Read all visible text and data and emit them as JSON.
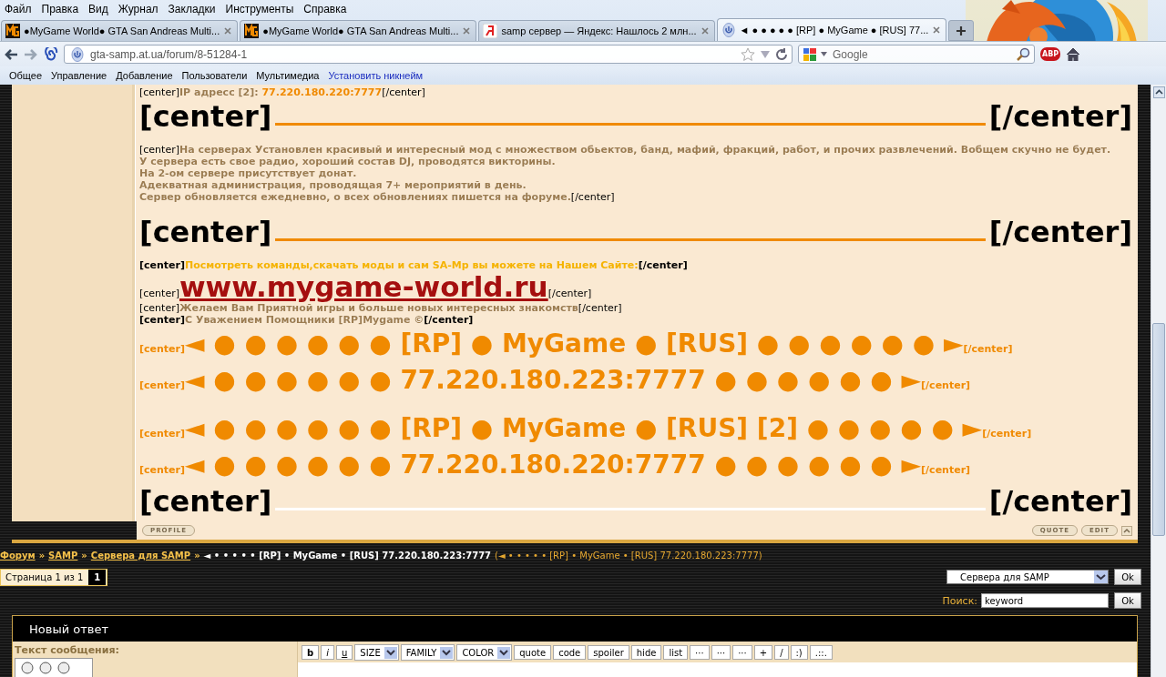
{
  "menu": [
    "Файл",
    "Правка",
    "Вид",
    "Журнал",
    "Закладки",
    "Инструменты",
    "Справка"
  ],
  "tabs": [
    {
      "title": "●MyGame World● GTA San Andreas Multi...",
      "kind": "game",
      "selected": false
    },
    {
      "title": "●MyGame World● GTA San Andreas Multi...",
      "kind": "game",
      "selected": false
    },
    {
      "title": "samp сервер — Яндекс: Нашлось 2 млн...",
      "kind": "search",
      "selected": false
    },
    {
      "title": "◄ ● ● ● ● ● [RP] ● MyGame ● [RUS] 77...",
      "kind": "site",
      "selected": true
    }
  ],
  "address": {
    "url": "gta-samp.at.ua/forum/8-51284-1"
  },
  "web_search": {
    "placeholder": "Google"
  },
  "addon_badge": "ABP",
  "bookmarks": [
    {
      "label": "Общее",
      "kind": "menu"
    },
    {
      "label": "Управление",
      "kind": "menu"
    },
    {
      "label": "Добавление",
      "kind": "menu"
    },
    {
      "label": "Пользователи",
      "kind": "menu"
    },
    {
      "label": "Мультимедиа",
      "kind": "menu"
    },
    {
      "label": "Установить никнейм",
      "kind": "link"
    }
  ],
  "post": {
    "lines": [
      {
        "kind": "text",
        "segments": [
          {
            "text": "[center]",
            "kind": "tag"
          },
          {
            "text": "IP адресс [2]: ",
            "kind": "white"
          },
          {
            "text": "77.220.180.220:7777",
            "kind": "orange"
          },
          {
            "text": "[/center]",
            "kind": "tag"
          }
        ]
      },
      {
        "kind": "divider",
        "left": "[center]",
        "right": "[/center]"
      },
      {
        "kind": "text",
        "segments": [
          {
            "text": "[center]",
            "kind": "tag"
          },
          {
            "text": "На серверах Установлен красивый и интересный мод с множеством обьектов, банд, мафий, фракций, работ, и прочих развлечений. Вобщем скучно не будет.",
            "kind": "white"
          }
        ]
      },
      {
        "kind": "text",
        "segments": [
          {
            "text": "У сервера есть свое радио, хороший состав DJ, проводятся викторины.",
            "kind": "white"
          }
        ]
      },
      {
        "kind": "text",
        "segments": [
          {
            "text": "На 2-ом сервере присутствует донат.",
            "kind": "white"
          }
        ]
      },
      {
        "kind": "text",
        "segments": [
          {
            "text": "Адекватная администрация, проводящая 7+ мероприятий в день.",
            "kind": "white"
          }
        ]
      },
      {
        "kind": "text",
        "segments": [
          {
            "text": "Сервер обновляется ежедневно, о всех обновлениях пишется на форуме.",
            "kind": "white"
          },
          {
            "text": "[/center]",
            "kind": "tag"
          }
        ]
      },
      {
        "kind": "divider",
        "left": "[center]",
        "right": "[/center]"
      },
      {
        "kind": "text",
        "segments": [
          {
            "text": "[center]",
            "kind": "tagb"
          },
          {
            "text": "Посмотреть команды,скачать моды и сам SA-Mp вы можете на Нашем Сайте:",
            "kind": "yellow"
          },
          {
            "text": "[/center]",
            "kind": "tagb"
          }
        ]
      },
      {
        "kind": "text",
        "segments": [
          {
            "text": "[center]",
            "kind": "tag"
          },
          {
            "text": "www.mygame-world.ru",
            "kind": "link"
          },
          {
            "text": "[/center]",
            "kind": "tag"
          }
        ]
      },
      {
        "kind": "text",
        "segments": [
          {
            "text": "[center]",
            "kind": "tag"
          },
          {
            "text": "Желаем Вам Приятной игры и больше новых интересных знакомств",
            "kind": "white"
          },
          {
            "text": "[/center]",
            "kind": "tag"
          }
        ]
      },
      {
        "kind": "text",
        "segments": [
          {
            "text": "[center]",
            "kind": "tagb"
          },
          {
            "text": "С Уважением Помощники [RP]Mygame ©",
            "kind": "white"
          },
          {
            "text": "[/center]",
            "kind": "tagb"
          }
        ]
      },
      {
        "kind": "banner",
        "segments": [
          {
            "text": "[center]",
            "kind": "tago"
          },
          {
            "text": "◄ ● ● ● ● ● ● [RP] ● MyGame ● [RUS] ● ● ● ● ● ● ►",
            "kind": "big"
          },
          {
            "text": "[/center]",
            "kind": "tago"
          }
        ]
      },
      {
        "kind": "banner",
        "segments": [
          {
            "text": "[center]",
            "kind": "tago"
          },
          {
            "text": "◄ ● ● ● ● ● ● 77.220.180.223:7777 ● ● ● ● ● ● ►",
            "kind": "big"
          },
          {
            "text": "[/center]",
            "kind": "tago"
          }
        ]
      },
      {
        "kind": "spacer"
      },
      {
        "kind": "banner",
        "segments": [
          {
            "text": "[center]",
            "kind": "tago"
          },
          {
            "text": "◄ ● ● ● ● ● ● [RP] ● MyGame ● [RUS] [2] ● ● ● ● ● ►",
            "kind": "big"
          },
          {
            "text": "[/center]",
            "kind": "tago"
          }
        ]
      },
      {
        "kind": "banner",
        "segments": [
          {
            "text": "[center]",
            "kind": "tago"
          },
          {
            "text": "◄ ● ● ● ● ● ● 77.220.180.220:7777 ● ● ● ● ● ● ►",
            "kind": "big"
          },
          {
            "text": "[/center]",
            "kind": "tago"
          }
        ]
      },
      {
        "kind": "divider_light",
        "left": "[center]",
        "right": "[/center]"
      }
    ],
    "actions_left": [
      "PROFILE"
    ],
    "actions_right": [
      "QUOTE",
      "EDIT"
    ]
  },
  "breadcrumb": [
    {
      "text": "Форум",
      "kind": "link"
    },
    {
      "text": "»",
      "kind": "sep"
    },
    {
      "text": "SAMP",
      "kind": "link"
    },
    {
      "text": "»",
      "kind": "sep"
    },
    {
      "text": "Сервера для SAMP",
      "kind": "link"
    },
    {
      "text": "»",
      "kind": "sep"
    },
    {
      "text": "◄ • • • • • [RP] • MyGame • [RUS] 77.220.180.223:7777",
      "kind": "current"
    },
    {
      "text": "(◄ • • • • • [RP] • MyGame • [RUS] 77.220.180.223:7777)",
      "kind": "subtitle"
    }
  ],
  "pager": {
    "label": "Страница 1 из 1",
    "pages": [
      {
        "label": "1",
        "selected": true
      }
    ]
  },
  "jump": {
    "value": "Сервера для SAMP",
    "button": "Ok"
  },
  "forum_search": {
    "label": "Поиск:",
    "value": "keyword",
    "button": "Ok"
  },
  "reply": {
    "title": "Новый ответ",
    "label": "Текст сообщения:",
    "toolbar": [
      {
        "label": "b",
        "kind": "bold"
      },
      {
        "label": "i",
        "kind": "italic"
      },
      {
        "label": "u",
        "kind": "underline"
      },
      {
        "label": "SIZE",
        "kind": "select"
      },
      {
        "label": "FAMILY",
        "kind": "select"
      },
      {
        "label": "COLOR",
        "kind": "select"
      },
      {
        "label": "quote",
        "kind": "button"
      },
      {
        "label": "code",
        "kind": "button"
      },
      {
        "label": "spoiler",
        "kind": "button"
      },
      {
        "label": "hide",
        "kind": "button"
      },
      {
        "label": "list",
        "kind": "button"
      },
      {
        "label": "···",
        "kind": "button"
      },
      {
        "label": "···",
        "kind": "button"
      },
      {
        "label": "···",
        "kind": "button"
      },
      {
        "label": "+",
        "kind": "button"
      },
      {
        "label": "/",
        "kind": "button"
      },
      {
        "label": ":)",
        "kind": "button"
      },
      {
        "label": ".::.",
        "kind": "button"
      }
    ]
  }
}
